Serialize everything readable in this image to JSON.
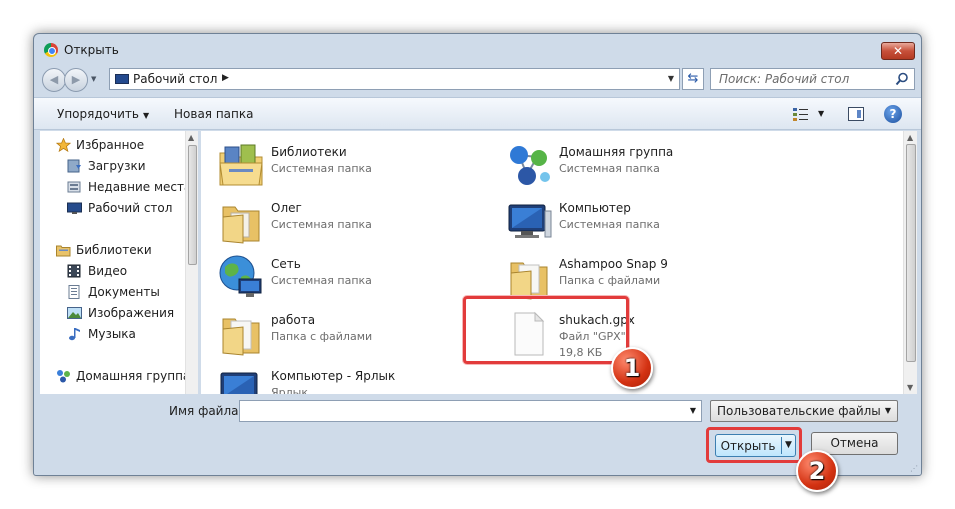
{
  "window": {
    "title": "Открыть",
    "close_label": "✕"
  },
  "nav": {
    "back": "◀",
    "forward": "▶",
    "address": "Рабочий стол",
    "search_placeholder": "Поиск: Рабочий стол"
  },
  "toolbar": {
    "organize": "Упорядочить",
    "new_folder": "Новая папка",
    "help": "?"
  },
  "sidebar": {
    "favorites": [
      {
        "label": "Избранное",
        "icon": "star-icon"
      },
      {
        "label": "Загрузки",
        "icon": "downloads-icon"
      },
      {
        "label": "Недавние места",
        "icon": "recent-places-icon"
      },
      {
        "label": "Рабочий стол",
        "icon": "desktop-icon"
      }
    ],
    "libraries": [
      {
        "label": "Библиотеки",
        "icon": "libraries-icon"
      },
      {
        "label": "Видео",
        "icon": "video-icon"
      },
      {
        "label": "Документы",
        "icon": "documents-icon"
      },
      {
        "label": "Изображения",
        "icon": "images-icon"
      },
      {
        "label": "Музыка",
        "icon": "music-icon"
      }
    ],
    "homegroup": {
      "label": "Домашняя группа",
      "icon": "homegroup-icon"
    }
  },
  "items": [
    {
      "name": "Библиотеки",
      "type": "Системная папка",
      "icon": "libraries-icon"
    },
    {
      "name": "Домашняя группа",
      "type": "Системная папка",
      "icon": "homegroup-icon"
    },
    {
      "name": "Олег",
      "type": "Системная папка",
      "icon": "user-folder-icon"
    },
    {
      "name": "Компьютер",
      "type": "Системная папка",
      "icon": "computer-icon"
    },
    {
      "name": "Сеть",
      "type": "Системная папка",
      "icon": "network-icon"
    },
    {
      "name": "Ashampoo Snap 9",
      "type": "Папка с файлами",
      "icon": "folder-icon"
    },
    {
      "name": "работа",
      "type": "Папка с файлами",
      "icon": "folder-icon"
    },
    {
      "name": "shukach.gpx",
      "type": "Файл \"GPX\"",
      "size": "19,8 КБ",
      "icon": "file-icon"
    },
    {
      "name": "Компьютер - Ярлык",
      "type": "Ярлык",
      "icon": "computer-shortcut-icon"
    }
  ],
  "bottom": {
    "filename_label": "Имя файла:",
    "filename_value": "",
    "file_type": "Пользовательские файлы",
    "open_label": "Открыть",
    "cancel_label": "Отмена"
  },
  "annotations": {
    "badge_1": "1",
    "badge_2": "2",
    "highlight_color": "#e23b3b"
  }
}
